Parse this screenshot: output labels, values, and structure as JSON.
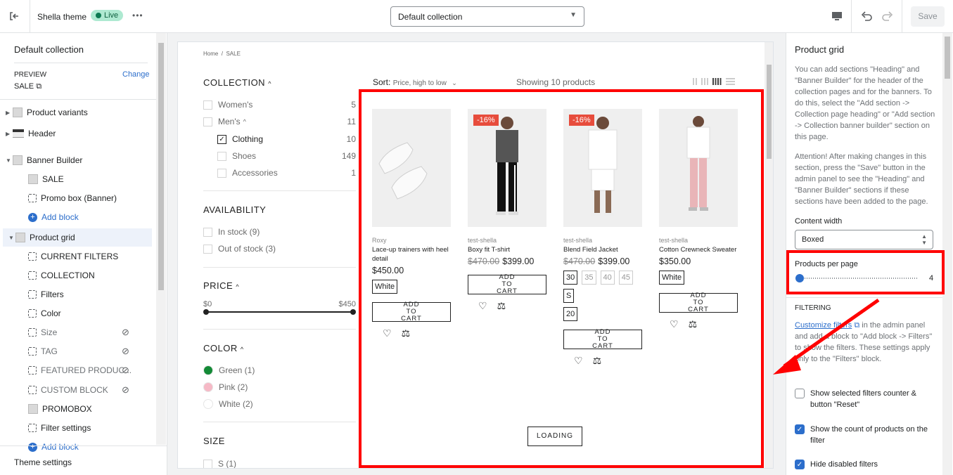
{
  "topbar": {
    "theme_name": "Shella theme",
    "live_label": "Live",
    "more_label": "•••",
    "template_select": "Default collection",
    "save_label": "Save"
  },
  "left": {
    "title": "Default collection",
    "preview_label": "PREVIEW",
    "change_label": "Change",
    "preview_value": "SALE",
    "items": [
      {
        "label": "Product variants",
        "indent": 0,
        "icon": "thumb",
        "expand": true
      },
      {
        "label": "Header",
        "indent": 0,
        "icon": "header",
        "expand": true
      },
      {
        "label": "Banner Builder",
        "indent": 0,
        "icon": "thumb",
        "expand": true,
        "open": true
      },
      {
        "label": "SALE",
        "indent": 1,
        "icon": "thumb"
      },
      {
        "label": "Promo box (Banner)",
        "indent": 1,
        "icon": "block"
      },
      {
        "label": "Add block",
        "indent": 1,
        "icon": "add"
      },
      {
        "label": "Product grid",
        "indent": 0,
        "icon": "thumb",
        "expand": true,
        "open": true,
        "selected": true
      },
      {
        "label": "CURRENT FILTERS",
        "indent": 1,
        "icon": "block"
      },
      {
        "label": "COLLECTION",
        "indent": 1,
        "icon": "block"
      },
      {
        "label": "Filters",
        "indent": 1,
        "icon": "block"
      },
      {
        "label": "Color",
        "indent": 1,
        "icon": "block"
      },
      {
        "label": "Size",
        "indent": 1,
        "icon": "block",
        "hidden": true
      },
      {
        "label": "TAG",
        "indent": 1,
        "icon": "block",
        "hidden": true
      },
      {
        "label": "FEATURED PRODUC...",
        "indent": 1,
        "icon": "block",
        "hidden": true
      },
      {
        "label": "CUSTOM BLOCK",
        "indent": 1,
        "icon": "block",
        "hidden": true
      },
      {
        "label": "PROMOBOX",
        "indent": 1,
        "icon": "thumb"
      },
      {
        "label": "Filter settings",
        "indent": 1,
        "icon": "block"
      },
      {
        "label": "Add block",
        "indent": 1,
        "icon": "add"
      }
    ],
    "theme_settings": "Theme settings"
  },
  "preview": {
    "breadcrumb": "Home  /  SALE",
    "sort_label": "Sort:",
    "sort_value": "Price, high to low",
    "showing": "Showing 10 products",
    "filters": {
      "collection": {
        "title": "COLLECTION",
        "items": [
          {
            "label": "Women's",
            "count": "5"
          },
          {
            "label": "Men's",
            "count": "11"
          },
          {
            "label": "Clothing",
            "count": "10",
            "checked": true
          },
          {
            "label": "Shoes",
            "count": "149"
          },
          {
            "label": "Accessories",
            "count": "1"
          }
        ]
      },
      "availability": {
        "title": "AVAILABILITY",
        "items": [
          "In stock (9)",
          "Out of stock (3)"
        ]
      },
      "price": {
        "title": "PRICE",
        "min": "$0",
        "max": "$450"
      },
      "color": {
        "title": "COLOR",
        "items": [
          {
            "label": "Green (1)",
            "color": "#138a36"
          },
          {
            "label": "Pink (2)",
            "color": "#f6b9c6"
          },
          {
            "label": "White (2)",
            "color": "#ffffff"
          }
        ]
      },
      "size": {
        "title": "SIZE",
        "items": [
          "S (1)"
        ]
      }
    },
    "products": [
      {
        "brand": "Roxy",
        "name": "Lace-up trainers with heel detail",
        "price": "$450.00",
        "old_price": "",
        "discount": "",
        "options": [
          "White"
        ],
        "atc": "ADD TO CART",
        "img": "shoes"
      },
      {
        "brand": "test-shella",
        "name": "Boxy fit T-shirt",
        "price": "$399.00",
        "old_price": "$470.00",
        "discount": "-16%",
        "options": [],
        "atc": "ADD TO CART",
        "img": "man"
      },
      {
        "brand": "test-shella",
        "name": "Blend Field Jacket",
        "price": "$399.00",
        "old_price": "$470.00",
        "discount": "-16%",
        "options": [
          "30",
          "35",
          "40",
          "45",
          "S",
          "20"
        ],
        "atc": "ADD TO CART",
        "img": "man2"
      },
      {
        "brand": "test-shella",
        "name": "Cotton Crewneck Sweater",
        "price": "$350.00",
        "old_price": "",
        "discount": "",
        "options": [
          "White"
        ],
        "atc": "ADD TO CART",
        "img": "woman"
      }
    ],
    "loading": "LOADING"
  },
  "right": {
    "title": "Product grid",
    "desc1": "You can add sections \"Heading\" and \"Banner Builder\" for the header of the collection pages and for the banners. To do this, select the \"Add section -> Collection page heading\" or \"Add section -> Collection banner builder\" section on this page.",
    "desc2": "Attention! After making changes in this section, press the \"Save\" button in the admin panel to see the \"Heading\" and \"Banner Builder\" sections if these sections have been added to the page.",
    "content_width_label": "Content width",
    "content_width_value": "Boxed",
    "ppp_label": "Products per page",
    "ppp_value": "4",
    "ppp_fraction": 0,
    "filtering_title": "FILTERING",
    "customize_link": "Customize filters",
    "filtering_desc": " in the admin panel and add a block to \"Add block -> Filters\" to show the filters. These settings apply only to the \"Filters\" block.",
    "checks": [
      {
        "label": "Show selected filters counter & button \"Reset\"",
        "checked": false
      },
      {
        "label": "Show the count of products on the filter",
        "checked": true
      },
      {
        "label": "Hide disabled filters",
        "checked": true
      }
    ]
  },
  "colors": {
    "highlight": "#ff0000",
    "accent": "#2c6ecb",
    "discount": "#e74c3c"
  }
}
